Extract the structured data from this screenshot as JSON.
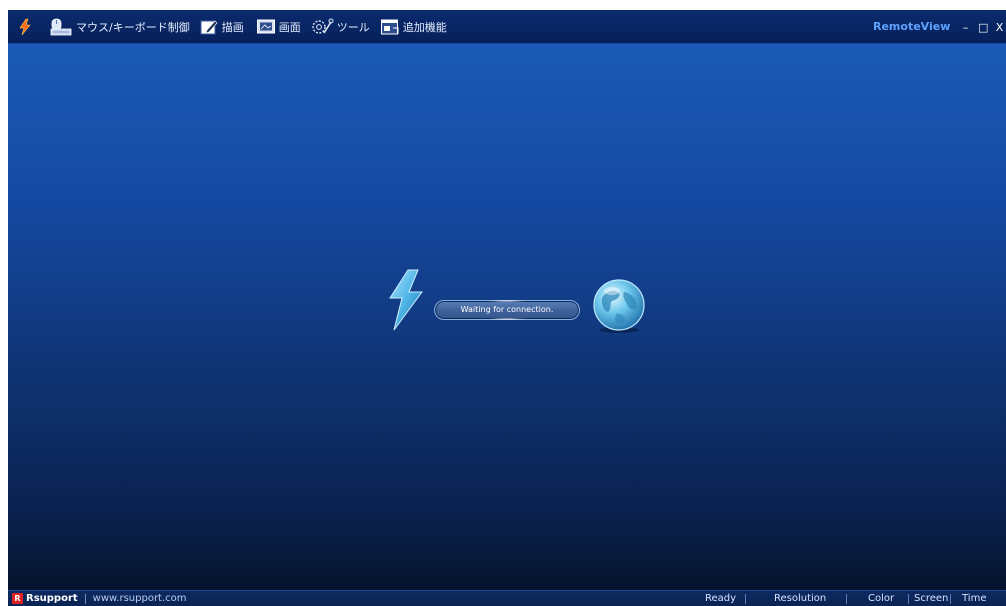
{
  "toolbar": {
    "items": [
      {
        "label": "マウス/キーボード制御",
        "icon": "mouse-keyboard-icon"
      },
      {
        "label": "描画",
        "icon": "draw-icon"
      },
      {
        "label": "画面",
        "icon": "screen-icon"
      },
      {
        "label": "ツール",
        "icon": "tools-icon"
      },
      {
        "label": "追加機能",
        "icon": "extra-functions-icon"
      }
    ]
  },
  "window": {
    "title": "RemoteView",
    "minimize": "–",
    "maximize": "□",
    "close": "X"
  },
  "connection": {
    "status_text": "Waiting for connection."
  },
  "statusbar": {
    "brand": "Rsupport",
    "brand_mark": "R",
    "url": "www.rsupport.com",
    "state": "Ready",
    "resolution": "Resolution",
    "color": "Color",
    "screen": "Screen",
    "time": "Time"
  },
  "colors": {
    "accent": "#5fa2ff",
    "titlebar": "#06205a",
    "viewport_top": "#1a5bb7",
    "viewport_bottom": "#06132d",
    "lightning": "#4fb4e6"
  }
}
